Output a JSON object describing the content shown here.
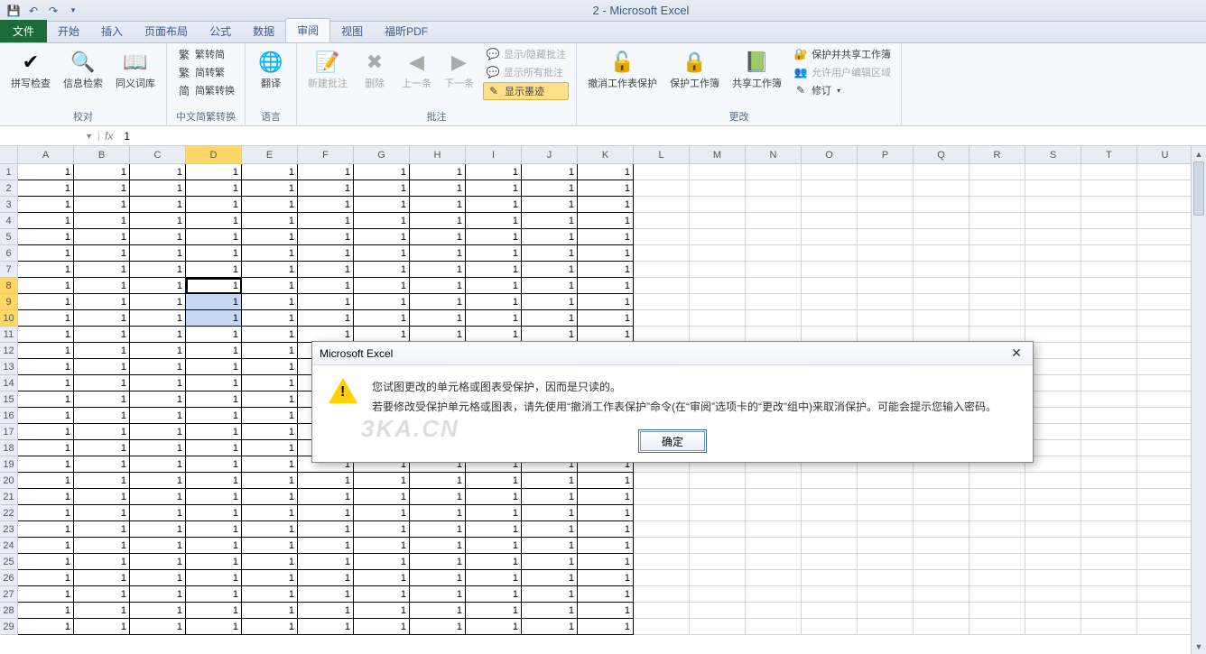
{
  "app": {
    "title": "2 - Microsoft Excel"
  },
  "tabs": {
    "file": "文件",
    "items": [
      "开始",
      "插入",
      "页面布局",
      "公式",
      "数据",
      "审阅",
      "视图",
      "福昕PDF"
    ],
    "active": "审阅"
  },
  "ribbon": {
    "proofing": {
      "label": "校对",
      "spelling": "拼写检查",
      "research": "信息检索",
      "thesaurus": "同义词库"
    },
    "chinese": {
      "label": "中文简繁转换",
      "to_simp": "繁转简",
      "to_trad": "简转繁",
      "convert": "简繁转换"
    },
    "language": {
      "label": "语言",
      "translate": "翻译"
    },
    "comments": {
      "label": "批注",
      "new": "新建批注",
      "delete": "删除",
      "prev": "上一条",
      "next": "下一条",
      "show_hide": "显示/隐藏批注",
      "show_all": "显示所有批注",
      "show_ink": "显示墨迹"
    },
    "changes": {
      "label": "更改",
      "unprotect_sheet": "撤消工作表保护",
      "protect_wb": "保护工作簿",
      "share_wb": "共享工作簿",
      "protect_share": "保护并共享工作簿",
      "allow_ranges": "允许用户编辑区域",
      "track": "修订"
    }
  },
  "namebox": "",
  "formula": "1",
  "grid": {
    "columns": [
      "A",
      "B",
      "C",
      "D",
      "E",
      "F",
      "G",
      "H",
      "I",
      "J",
      "K",
      "L",
      "M",
      "N",
      "O",
      "P",
      "Q",
      "R",
      "S",
      "T",
      "U"
    ],
    "row_count": 29,
    "data_cols": 11,
    "cell_value": "1",
    "active_col": "D",
    "active_row": 8,
    "sel_rows": [
      8,
      9,
      10
    ]
  },
  "dialog": {
    "title": "Microsoft Excel",
    "line1": "您试图更改的单元格或图表受保护，因而是只读的。",
    "line2": "若要修改受保护单元格或图表，请先使用“撤消工作表保护”命令(在“审阅”选项卡的“更改”组中)来取消保护。可能会提示您输入密码。",
    "ok": "确定"
  },
  "watermark": "3KA.CN"
}
